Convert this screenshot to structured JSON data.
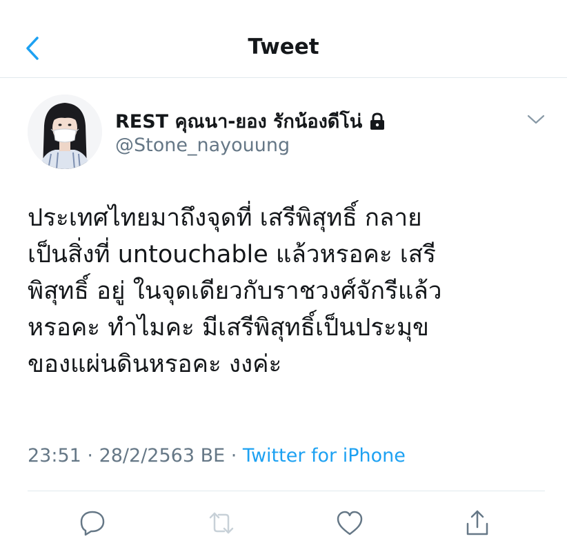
{
  "nav": {
    "title": "Tweet",
    "back_icon": "chevron-left-icon",
    "accent": "#1da1f2"
  },
  "author": {
    "display_name": "REST คุณนา-ยอง รักน้องดีโน่",
    "handle": "@Stone_nayouung",
    "protected_icon": "lock-icon"
  },
  "tweet": {
    "lines": [
      "ประเทศไทยมาถึงจุดที่ เสรีพิสุทธิ์ กลาย",
      "เป็นสิ่งที่ untouchable แล้วหรอคะ เสรี",
      "พิสุทธิ์ อยู่ ในจุดเดียวกับราชวงศ์จักรีแล้ว",
      "หรอคะ ทำไมคะ มีเสรีพิสุทธิ์เป็นประมุข",
      "ของแผ่นดินหรอคะ งงค่ะ"
    ],
    "time": "23:51",
    "separator1": " · ",
    "date": "28/2/2563 BE",
    "separator2": " · ",
    "source": "Twitter for iPhone"
  },
  "actions": {
    "reply_icon": "reply-icon",
    "retweet_icon": "retweet-icon",
    "like_icon": "heart-icon",
    "share_icon": "share-icon"
  },
  "colors": {
    "text": "#14171a",
    "secondary": "#657786",
    "link": "#1da1f2",
    "divider": "#e1e8ed"
  }
}
